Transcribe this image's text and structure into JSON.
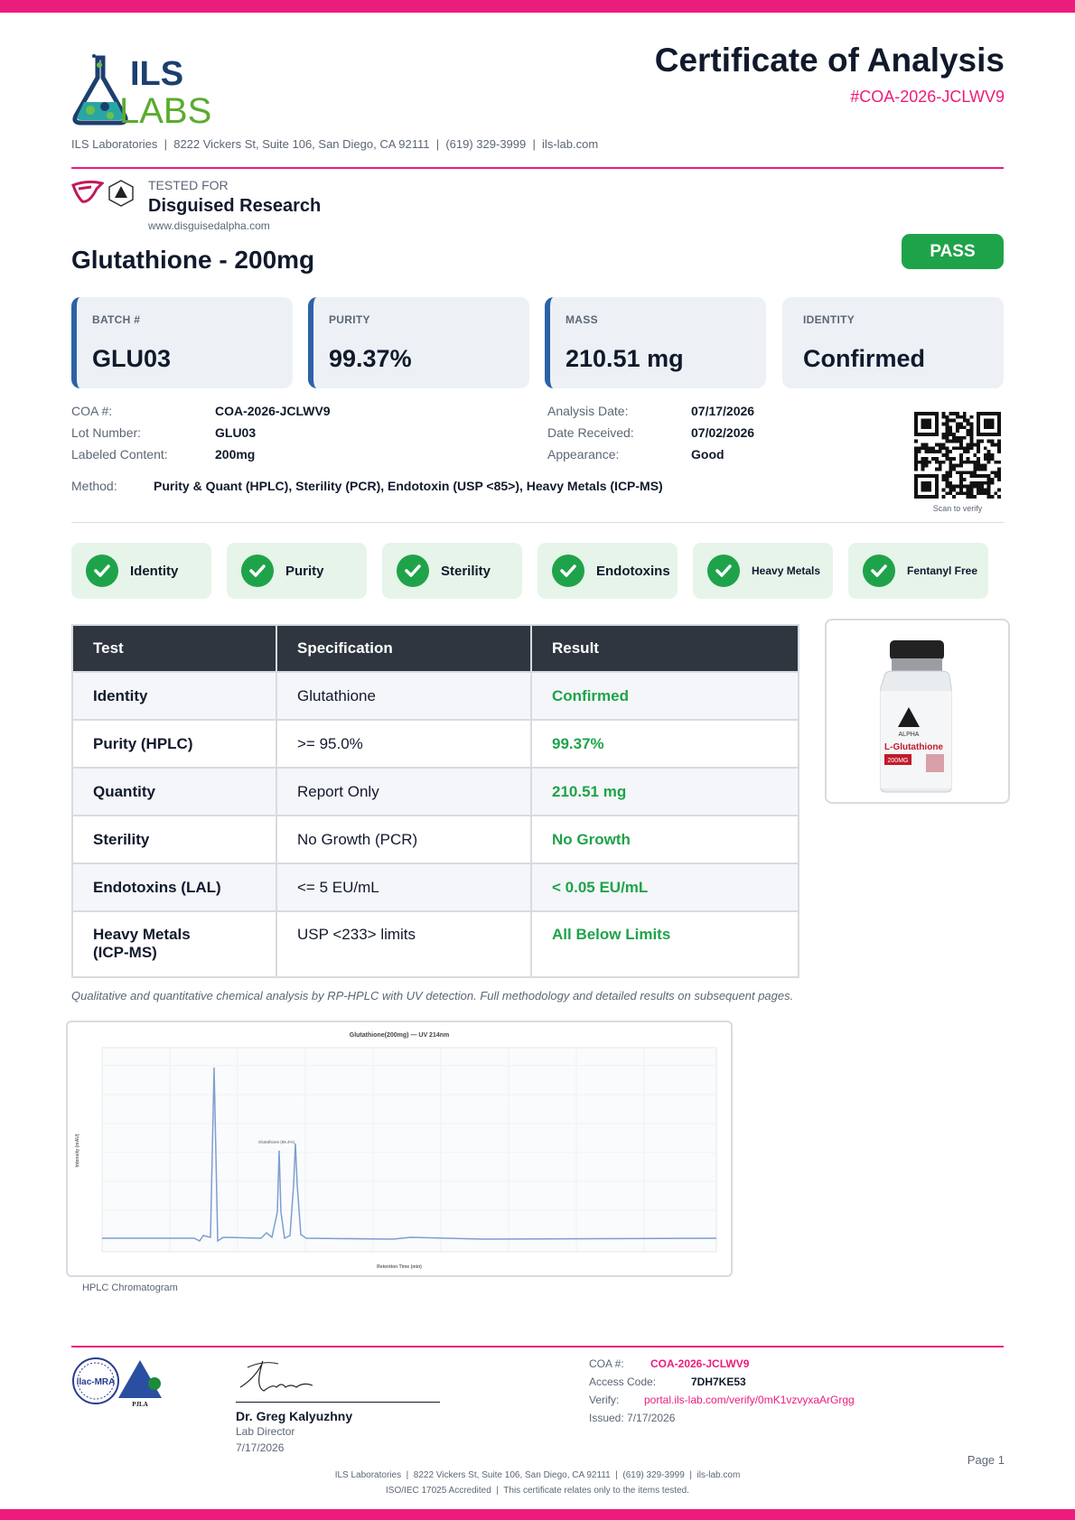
{
  "header": {
    "logo_text_line1": "ILS",
    "logo_text_line2": "LABS",
    "title": "Certificate of Analysis",
    "coa_id": "#COA-2026-JCLWV9",
    "address_line": "ILS Laboratories  |  8222 Vickers St, Suite 106, San Diego, CA 92111  |  (619) 329-3999  |  ils-lab.com"
  },
  "tested_for": {
    "label": "TESTED FOR",
    "name": "Disguised Research",
    "url": "www.disguisedalpha.com"
  },
  "product": {
    "name": "Glutathione - 200mg",
    "status": "PASS"
  },
  "summary_cards": [
    {
      "label": "BATCH #",
      "value": "GLU03"
    },
    {
      "label": "PURITY",
      "value": "99.37%"
    },
    {
      "label": "MASS",
      "value": "210.51 mg"
    },
    {
      "label": "IDENTITY",
      "value": "Confirmed"
    }
  ],
  "info_left": [
    {
      "key": "COA #:",
      "value": "COA-2026-JCLWV9"
    },
    {
      "key": "Lot Number:",
      "value": "GLU03"
    },
    {
      "key": "Labeled Content:",
      "value": "200mg"
    }
  ],
  "info_right": [
    {
      "key": "Analysis Date:",
      "value": "07/17/2026"
    },
    {
      "key": "Date Received:",
      "value": "07/02/2026"
    },
    {
      "key": "Appearance:",
      "value": "Good"
    }
  ],
  "method": {
    "key": "Method:",
    "value": "Purity & Quant (HPLC), Sterility (PCR), Endotoxin (USP <85>), Heavy Metals (ICP-MS)"
  },
  "qr": {
    "caption": "Scan to verify"
  },
  "checks": [
    "Identity",
    "Purity",
    "Sterility",
    "Endotoxins",
    "Heavy Metals",
    "Fentanyl Free"
  ],
  "results_table": {
    "headers": [
      "Test",
      "Specification",
      "Result"
    ],
    "rows": [
      {
        "test": "Identity",
        "spec": "Glutathione",
        "result": "Confirmed"
      },
      {
        "test": "Purity (HPLC)",
        "spec": ">= 95.0%",
        "result": "99.37%"
      },
      {
        "test": "Quantity",
        "spec": "Report Only",
        "result": "210.51 mg"
      },
      {
        "test": "Sterility",
        "spec": "No Growth (PCR)",
        "result": "No Growth"
      },
      {
        "test": "Endotoxins (LAL)",
        "spec": "<= 5 EU/mL",
        "result": "< 0.05 EU/mL"
      },
      {
        "test": "Heavy Metals (ICP-MS)",
        "spec": "USP <233> limits",
        "result": "All Below Limits"
      }
    ]
  },
  "vial": {
    "brand": "ALPHA",
    "label": "L-Glutathione",
    "dose": "200MG"
  },
  "method_note": "Qualitative and quantitative chemical analysis by RP-HPLC with UV detection. Full methodology and detailed results on subsequent pages.",
  "chromatogram": {
    "title": "Glutathione(200mg) — UV 214nm",
    "caption": "HPLC Chromatogram",
    "peak_label": "Glutathione (96.4%)",
    "xlabel": "Retention Time (min)",
    "ylabel": "Intensity (mAU)"
  },
  "signature": {
    "name": "Dr. Greg Kalyuzhny",
    "role": "Lab Director",
    "date": "7/17/2026"
  },
  "verification": {
    "coa_key": "COA #:",
    "coa_value": "COA-2026-JCLWV9",
    "access_key": "Access Code:",
    "access_value": "7DH7KE53",
    "verify_key": "Verify:",
    "verify_value": "portal.ils-lab.com/verify/0mK1vzvyxaArGrgg",
    "issued": "Issued: 7/17/2026"
  },
  "accreditation": {
    "ilac": "ilac-MRA",
    "pjla": "PJLA"
  },
  "footer": {
    "page": "Page 1",
    "line1": "ILS Laboratories  |  8222 Vickers St, Suite 106, San Diego, CA 92111  |  (619) 329-3999  |  ils-lab.com",
    "line2": "ISO/IEC 17025 Accredited  |  This certificate relates only to the items tested."
  },
  "colors": {
    "accent": "#ec1c7c",
    "pass": "#1fa34a",
    "dark": "#111a2c",
    "card_bar": "#2b62a6"
  }
}
